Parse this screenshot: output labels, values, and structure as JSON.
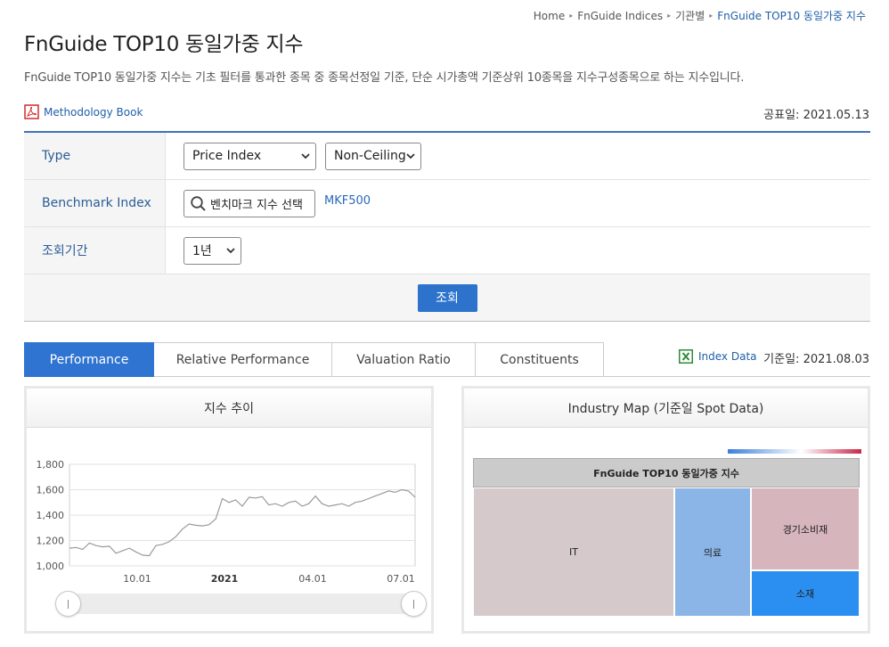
{
  "breadcrumb": [
    "Home",
    "FnGuide Indices",
    "기관별",
    "FnGuide TOP10 동일가중 지수"
  ],
  "title": "FnGuide TOP10 동일가중 지수",
  "description": "FnGuide TOP10 동일가중 지수는 기초 필터를 통과한 종목 중 종목선정일 기준, 단순 시가총액 기준상위 10종목을 지수구성종목으로 하는 지수입니다.",
  "methodology_link": "Methodology Book",
  "publish_date": "공표일: 2021.05.13",
  "filters": {
    "type_label": "Type",
    "type_value": "Price Index",
    "ceiling_value": "Non-Ceiling",
    "benchmark_label": "Benchmark Index",
    "benchmark_placeholder": "벤치마크 지수 선택",
    "benchmark_value": "MKF500",
    "period_label": "조회기간",
    "period_value": "1년",
    "submit_label": "조회"
  },
  "tabs": [
    "Performance",
    "Relative Performance",
    "Valuation Ratio",
    "Constituents"
  ],
  "index_data_link": "Index Data",
  "base_date": "기준일: 2021.08.03",
  "chart_panel": {
    "title": "지수 추이"
  },
  "industry_panel": {
    "title": "Industry Map (기준일 Spot Data)"
  },
  "chart_data": {
    "type": "line",
    "title": "지수 추이",
    "ylim": [
      1000,
      1800
    ],
    "yticks": [
      "1,800",
      "1,600",
      "1,400",
      "1,200",
      "1,000"
    ],
    "xticks": [
      "10.01",
      "2021",
      "04.01",
      "07.01"
    ],
    "grid": true,
    "series": [
      {
        "values": [
          1140,
          1145,
          1130,
          1180,
          1160,
          1150,
          1155,
          1100,
          1120,
          1140,
          1110,
          1085,
          1080,
          1160,
          1170,
          1190,
          1230,
          1290,
          1330,
          1320,
          1315,
          1325,
          1370,
          1530,
          1500,
          1520,
          1470,
          1540,
          1535,
          1545,
          1480,
          1490,
          1470,
          1500,
          1510,
          1470,
          1490,
          1550,
          1490,
          1470,
          1480,
          1490,
          1470,
          1500,
          1510,
          1530,
          1550,
          1570,
          1590,
          1580,
          1600,
          1590,
          1540
        ]
      }
    ]
  },
  "treemap": {
    "header": "FnGuide TOP10 동일가중 지수",
    "cells": [
      {
        "label": "IT",
        "color": "#d5c9cc"
      },
      {
        "label": "의료",
        "color": "#8ab5e6"
      },
      {
        "label": "경기소비재",
        "color": "#d6b5bd"
      },
      {
        "label": "소재",
        "color": "#2a8ff0"
      }
    ]
  }
}
